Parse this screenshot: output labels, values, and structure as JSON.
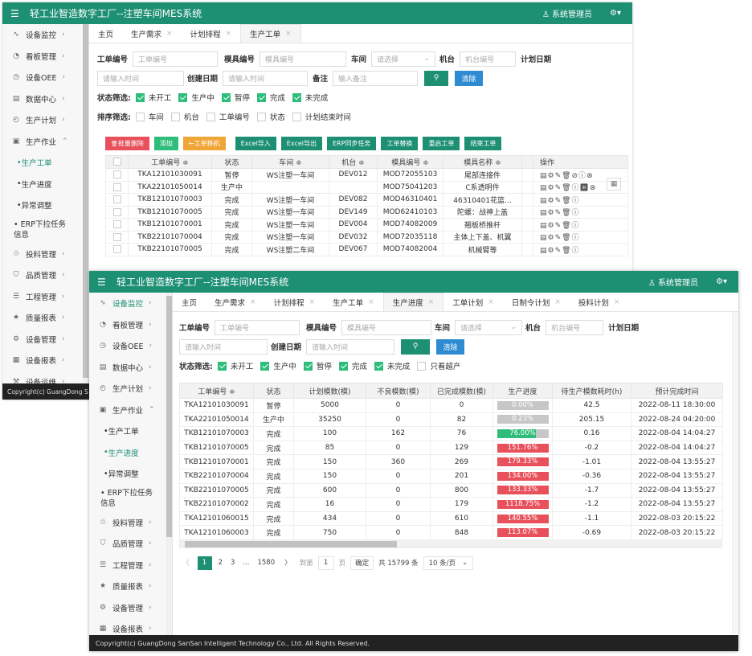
{
  "app_title": "轻工业智造数字工厂--注塑车间MES系统",
  "user": "系统管理员",
  "footer": "Copyright(c) GuangDong SanSan Intelligent Technology Co., Ltd. All Rights Reserved.",
  "footer_short": "Copyright(c) GuangDong S",
  "colors": {
    "brand": "#1d8f73",
    "blue": "#2e8bd1",
    "red": "#e8505b",
    "green": "#2ebd7a"
  },
  "sidebar": {
    "items": [
      {
        "icon": "monitor-icon",
        "label": "设备监控"
      },
      {
        "icon": "dashboard-icon",
        "label": "看板管理"
      },
      {
        "icon": "oee-icon",
        "label": "设备OEE"
      },
      {
        "icon": "data-center-icon",
        "label": "数据中心"
      },
      {
        "icon": "clock-icon",
        "label": "生产计划"
      },
      {
        "icon": "document-icon",
        "label": "生产作业"
      }
    ],
    "sub": [
      "生产工单",
      "生产进度",
      "异常调整",
      "ERP下拉任务信息"
    ],
    "sub_erp_1": "ERP下拉任务",
    "sub_erp_2": "信息",
    "items_after": [
      {
        "icon": "material-icon",
        "label": "投料管理"
      },
      {
        "icon": "shield-icon",
        "label": "品质管理"
      },
      {
        "icon": "process-icon",
        "label": "工程管理"
      },
      {
        "icon": "star-icon",
        "label": "质量报表"
      },
      {
        "icon": "gear-icon",
        "label": "设备管理"
      },
      {
        "icon": "report-icon",
        "label": "设备报表"
      },
      {
        "icon": "wrench-icon",
        "label": "设备运维"
      }
    ]
  },
  "win1": {
    "tabs": [
      "主页",
      "生产需求",
      "计划排程",
      "生产工单"
    ],
    "filters": {
      "order_no_label": "工单编号",
      "order_no_ph": "工单编号",
      "mold_no_label": "模具编号",
      "mold_no_ph": "模具编号",
      "workshop_label": "车间",
      "workshop_ph": "请选择",
      "machine_label": "机台",
      "machine_ph": "机台编号",
      "plan_date_label": "计划日期",
      "plan_date_ph": "请输入时间",
      "create_date_label": "创建日期",
      "create_date_ph": "请输入时间",
      "remark_label": "备注",
      "remark_ph": "输入备注",
      "clear": "清除"
    },
    "status_label": "状态筛选:",
    "status_opts": [
      "未开工",
      "生产中",
      "暂停",
      "完成",
      "未完成"
    ],
    "sort_label": "排序筛选:",
    "sort_opts": [
      "车间",
      "机台",
      "工单编号",
      "状态",
      "计划结束时间"
    ],
    "toolbar": [
      {
        "label": "批量删除",
        "color": "#e8505b"
      },
      {
        "label": "添加",
        "color": "#2ebd7a"
      },
      {
        "label": "←工单移机",
        "color": "#f0a537"
      },
      {
        "label": "Excel导入",
        "color": "#1d8f73"
      },
      {
        "label": "Excel导出",
        "color": "#1d8f73"
      },
      {
        "label": "ERP同步任务",
        "color": "#1d8f73"
      },
      {
        "label": "工单替换",
        "color": "#1d8f73"
      },
      {
        "label": "重启工单",
        "color": "#1d8f73"
      },
      {
        "label": "结束工单",
        "color": "#1d8f73"
      }
    ],
    "columns": [
      "工单编号 ≑",
      "状态",
      "车间 ≑",
      "机台 ≑",
      "模具编号 ≑",
      "模具名称 ≑",
      "操作"
    ],
    "rows": [
      {
        "no": "TKA12101030091",
        "status": "暂停",
        "ws": "WS注塑一车间",
        "mc": "DEV012",
        "mold": "MOD72055103",
        "name": "尾部连接件",
        "ops": "▤⚙✎🗑⊘ⓘ⊗"
      },
      {
        "no": "TKA22101050014",
        "status": "生产中",
        "ws": "",
        "mc": "",
        "mold": "MOD75041203",
        "name": "C系透明件",
        "ops": "▤⚙✎🗑ⓘ⏸⊗"
      },
      {
        "no": "TKB12101070003",
        "status": "完成",
        "ws": "WS注塑一车间",
        "mc": "DEV082",
        "mold": "MOD46310401",
        "name": "46310401花篮...",
        "ops": "▤⚙✎🗑ⓘ"
      },
      {
        "no": "TKB12101070005",
        "status": "完成",
        "ws": "WS注塑一车间",
        "mc": "DEV149",
        "mold": "MOD62410103",
        "name": "陀螺：战神上盖",
        "ops": "▤⚙✎🗑ⓘ"
      },
      {
        "no": "TKB12101070001",
        "status": "完成",
        "ws": "WS注塑一车间",
        "mc": "DEV004",
        "mold": "MOD74082009",
        "name": "翘板桥推杆",
        "ops": "▤⚙✎🗑ⓘ"
      },
      {
        "no": "TKB22101070004",
        "status": "完成",
        "ws": "WS注塑一车间",
        "mc": "DEV032",
        "mold": "MOD72035118",
        "name": "主体上下盖、机翼",
        "ops": "▤⚙✎🗑ⓘ"
      },
      {
        "no": "TKB22101070005",
        "status": "完成",
        "ws": "WS注塑二车间",
        "mc": "DEV067",
        "mold": "MOD74082004",
        "name": "机械臂等",
        "ops": "▤⚙✎🗑ⓘ"
      }
    ]
  },
  "win2": {
    "tabs": [
      "主页",
      "生产需求",
      "计划排程",
      "生产工单",
      "生产进度",
      "工单计划",
      "日制令计划",
      "投料计划"
    ],
    "filters": {
      "order_no_label": "工单编号",
      "order_no_ph": "工单编号",
      "mold_no_label": "模具编号",
      "mold_no_ph": "模具编号",
      "workshop_label": "车间",
      "workshop_ph": "请选择",
      "machine_label": "机台",
      "machine_ph": "机台编号",
      "plan_date_label": "计划日期",
      "plan_date_ph": "请输入时间",
      "create_date_label": "创建日期",
      "create_date_ph": "请输入时间",
      "clear": "清除"
    },
    "status_label": "状态筛选:",
    "status_opts": [
      "未开工",
      "生产中",
      "暂停",
      "完成",
      "未完成",
      "只看超产"
    ],
    "columns": [
      "工单编号 ≑",
      "状态",
      "计划模数(模)",
      "不良模数(模)",
      "已完成模数(模)",
      "生产进度",
      "待生产模数耗时(h)",
      "预计完成时间"
    ],
    "rows": [
      {
        "no": "TKA12101030091",
        "status": "暂停",
        "plan": "5000",
        "bad": "0",
        "done": "0",
        "prog": "0.00%",
        "pct": 0,
        "tone": "gray",
        "hours": "42.5",
        "eta": "2022-08-11 18:30:00"
      },
      {
        "no": "TKA22101050014",
        "status": "生产中",
        "plan": "35250",
        "bad": "0",
        "done": "82",
        "prog": "0.23%",
        "pct": 0.23,
        "tone": "gray",
        "hours": "205.15",
        "eta": "2022-08-24 04:20:00"
      },
      {
        "no": "TKB12101070003",
        "status": "完成",
        "plan": "100",
        "bad": "162",
        "done": "76",
        "prog": "76.00%",
        "pct": 76,
        "tone": "green",
        "hours": "0.16",
        "eta": "2022-08-04 14:04:27"
      },
      {
        "no": "TKB12101070005",
        "status": "完成",
        "plan": "85",
        "bad": "0",
        "done": "129",
        "prog": "151.76%",
        "pct": 100,
        "tone": "red",
        "hours": "-0.2",
        "eta": "2022-08-04 14:04:27"
      },
      {
        "no": "TKB12101070001",
        "status": "完成",
        "plan": "150",
        "bad": "360",
        "done": "269",
        "prog": "179.33%",
        "pct": 100,
        "tone": "red",
        "hours": "-1.01",
        "eta": "2022-08-04 13:55:27"
      },
      {
        "no": "TKB22101070004",
        "status": "完成",
        "plan": "150",
        "bad": "0",
        "done": "201",
        "prog": "134.00%",
        "pct": 100,
        "tone": "red",
        "hours": "-0.36",
        "eta": "2022-08-04 13:55:27"
      },
      {
        "no": "TKB22101070005",
        "status": "完成",
        "plan": "600",
        "bad": "0",
        "done": "800",
        "prog": "133.33%",
        "pct": 100,
        "tone": "red",
        "hours": "-1.7",
        "eta": "2022-08-04 13:55:27"
      },
      {
        "no": "TKB22101070002",
        "status": "完成",
        "plan": "16",
        "bad": "0",
        "done": "179",
        "prog": "1118.75%",
        "pct": 100,
        "tone": "red",
        "hours": "-1.2",
        "eta": "2022-08-04 13:55:27"
      },
      {
        "no": "TKA12101060015",
        "status": "完成",
        "plan": "434",
        "bad": "0",
        "done": "610",
        "prog": "140.55%",
        "pct": 100,
        "tone": "red",
        "hours": "-1.1",
        "eta": "2022-08-03 20:15:22"
      },
      {
        "no": "TKA12101060003",
        "status": "完成",
        "plan": "750",
        "bad": "0",
        "done": "848",
        "prog": "113.07%",
        "pct": 100,
        "tone": "red",
        "hours": "-0.69",
        "eta": "2022-08-03 20:15:22"
      }
    ],
    "pager": {
      "prev": "〈",
      "pages": [
        "1",
        "2",
        "3",
        "...",
        "1580"
      ],
      "next": "〉",
      "goto": "到第",
      "page_val": "1",
      "page_unit": "页",
      "confirm": "确定",
      "total": "共 15799 条",
      "size": "10 条/页"
    }
  }
}
